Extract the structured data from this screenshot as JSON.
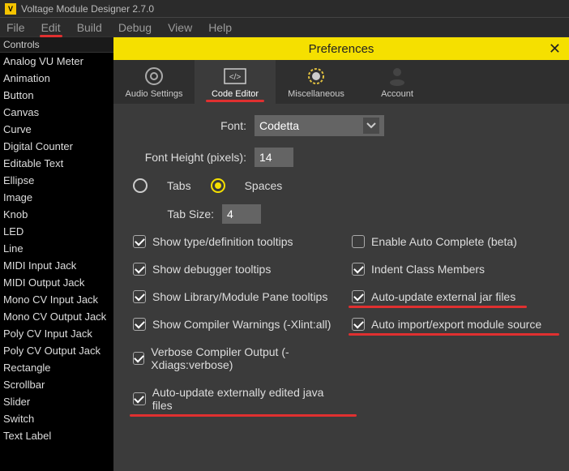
{
  "app": {
    "title": "Voltage Module Designer 2.7.0"
  },
  "menubar": [
    "File",
    "Edit",
    "Build",
    "Debug",
    "View",
    "Help"
  ],
  "sidepanel": {
    "header": "Controls",
    "items": [
      "Analog VU Meter",
      "Animation",
      "Button",
      "Canvas",
      "Curve",
      "Digital Counter",
      "Editable Text",
      "Ellipse",
      "Image",
      "Knob",
      "LED",
      "Line",
      "MIDI Input Jack",
      "MIDI Output Jack",
      "Mono CV Input Jack",
      "Mono CV Output Jack",
      "Poly CV Input Jack",
      "Poly CV Output Jack",
      "Rectangle",
      "Scrollbar",
      "Slider",
      "Switch",
      "Text Label"
    ]
  },
  "dialog": {
    "title": "Preferences",
    "tabs": [
      "Audio Settings",
      "Code Editor",
      "Miscellaneous",
      "Account"
    ],
    "font_label": "Font:",
    "font_value": "Codetta",
    "font_height_label": "Font Height (pixels):",
    "font_height_value": "14",
    "tabs_radio": "Tabs",
    "spaces_radio": "Spaces",
    "tab_size_label": "Tab Size:",
    "tab_size_value": "4",
    "checks": {
      "c0": "Show type/definition tooltips",
      "c1": "Enable Auto Complete (beta)",
      "c2": "Show debugger tooltips",
      "c3": "Indent Class Members",
      "c4": "Show Library/Module Pane tooltips",
      "c5": "Auto-update external jar files",
      "c6": "Show Compiler Warnings (-Xlint:all)",
      "c7": "Auto import/export module source",
      "c8": "Verbose Compiler Output (-Xdiags:verbose)",
      "c9": "Auto-update externally edited java files"
    }
  }
}
